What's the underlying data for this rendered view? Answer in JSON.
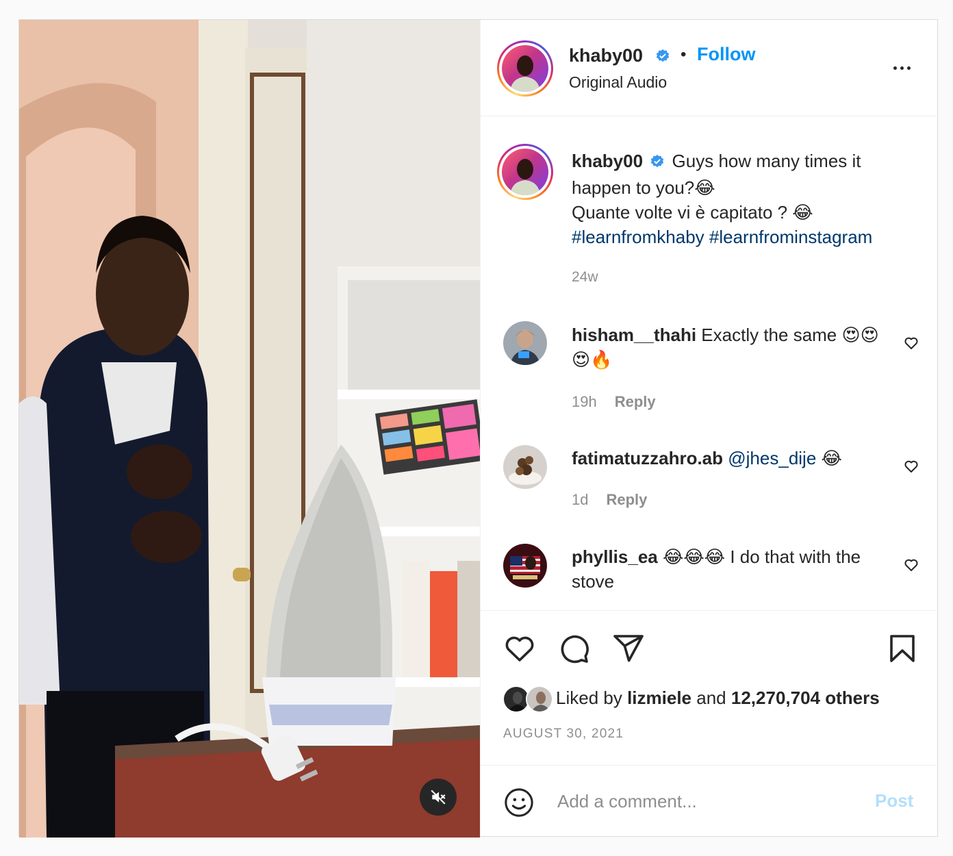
{
  "post": {
    "author": {
      "username": "khaby00",
      "verified": true,
      "follow_label": "Follow",
      "separator": "•",
      "audio": "Original Audio"
    },
    "caption": {
      "username": "khaby00",
      "line1": "Guys how many times it happen to you?😂",
      "line2": "Quante volte vi è capitato ? 😂",
      "hashtag1": "#learnfromkhaby",
      "hashtag2": "#learnfrominstagram",
      "time": "24w"
    },
    "comments": [
      {
        "username": "hisham__thahi",
        "text": "Exactly the same 😍😍😍🔥",
        "time": "19h",
        "reply_label": "Reply"
      },
      {
        "username": "fatimatuzzahro.ab",
        "mention": "@jhes_dije",
        "text": " 😂",
        "time": "1d",
        "reply_label": "Reply"
      },
      {
        "username": "phyllis_ea",
        "text": "😂😂😂 I do that with the stove"
      }
    ],
    "likes": {
      "prefix": "Liked by",
      "user": "lizmiele",
      "joiner": "and",
      "count": "12,270,704 others"
    },
    "date": "AUGUST 30, 2021",
    "add_comment": {
      "placeholder": "Add a comment...",
      "post_label": "Post"
    }
  },
  "colors": {
    "accent": "#0095f6",
    "hashtag": "#00376b",
    "muted": "#8e8e8e",
    "post_disabled": "#b2dffc"
  },
  "icons": [
    "muted-speaker-icon",
    "more-options-icon",
    "verified-badge-icon",
    "heart-icon",
    "comment-icon",
    "share-icon",
    "bookmark-icon",
    "emoji-icon"
  ]
}
